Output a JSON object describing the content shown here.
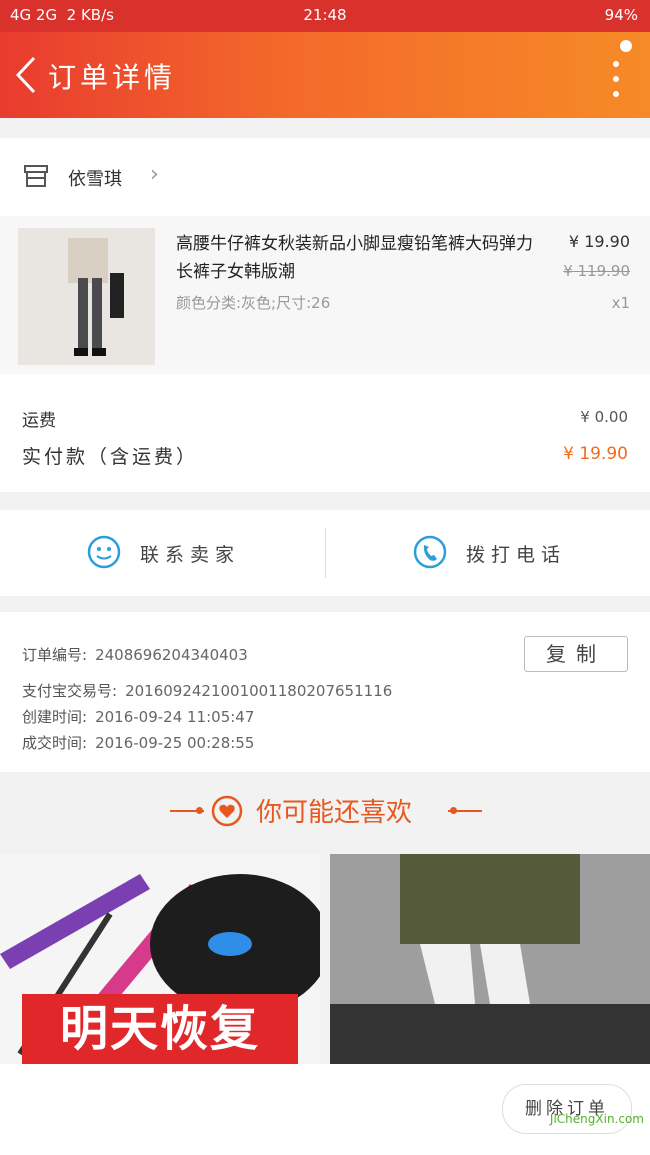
{
  "status_bar": {
    "network": "4G 2G",
    "speed": "2 KB/s",
    "time": "21:48",
    "battery": "94%"
  },
  "header": {
    "title": "订单详情"
  },
  "shop": {
    "name": "依雪琪"
  },
  "item": {
    "name": "高腰牛仔裤女秋装新品小脚显瘦铅笔裤大码弹力长裤子女韩版潮",
    "spec": "颜色分类:灰色;尺寸:26",
    "price": "¥ 19.90",
    "original_price": "¥ 119.90",
    "quantity": "x1"
  },
  "fees": {
    "shipping_label": "运费",
    "shipping_value": "¥ 0.00",
    "paid_label": "实付款（含运费）",
    "paid_value": "¥ 19.90"
  },
  "actions": {
    "contact_seller": "联系卖家",
    "call_phone": "拨打电话"
  },
  "order_info": {
    "order_no_label": "订单编号:",
    "order_no": "2408696204340403",
    "copy_button": "复制",
    "alipay_label": "支付宝交易号:",
    "alipay_no": "2016092421001001180207651116",
    "created_label": "创建时间:",
    "created": "2016-09-24 11:05:47",
    "deal_label": "成交时间:",
    "deal": "2016-09-25 00:28:55"
  },
  "recommend": {
    "title": "你可能还喜欢",
    "product1_banner": "明天恢复"
  },
  "bottom": {
    "delete_button": "删除订单",
    "watermark": "JiChengXin.com"
  },
  "colors": {
    "accent": "#f26a1b",
    "header_start": "#e83b2f",
    "header_end": "#f78a28"
  }
}
